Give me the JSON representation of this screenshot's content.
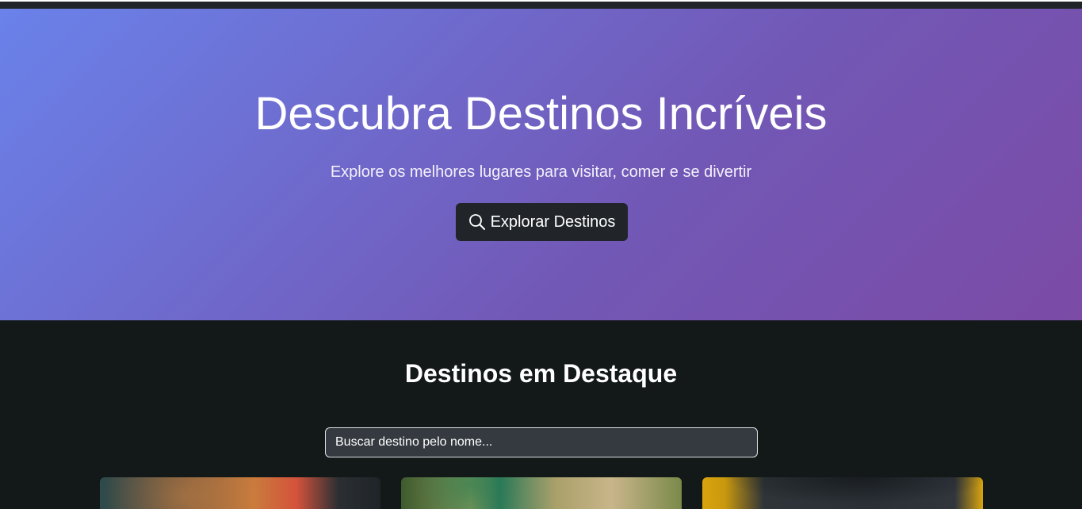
{
  "hero": {
    "title": "Descubra Destinos Incríveis",
    "subtitle": "Explore os melhores lugares para visitar, comer e se divertir",
    "button_label": "Explorar Destinos",
    "button_icon": "search-icon",
    "gradient_start": "#6a82ea",
    "gradient_end": "#7b4ba6"
  },
  "featured": {
    "title": "Destinos em Destaque",
    "search_placeholder": "Buscar destino pelo nome...",
    "search_value": ""
  },
  "colors": {
    "dark": "#212529",
    "section_bg": "#131818",
    "input_bg": "#343a40"
  }
}
